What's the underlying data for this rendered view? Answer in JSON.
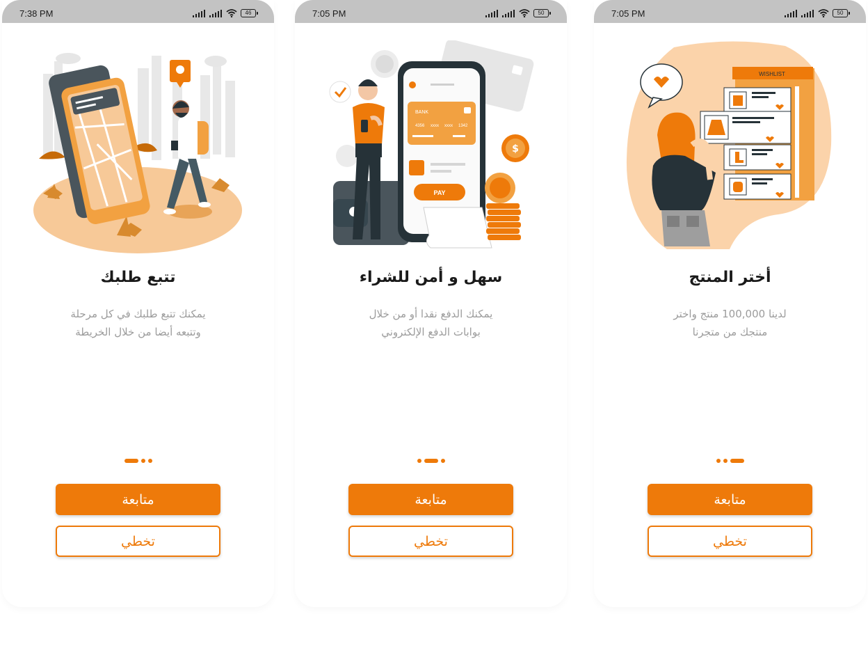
{
  "colors": {
    "accent": "#ee7a0a",
    "status_bar": "#c3c3c3",
    "description_text": "#9c9c9c"
  },
  "screens": [
    {
      "status": {
        "time": "7:38 PM",
        "battery": "46"
      },
      "illustration": "order-tracking-map-illustration",
      "title": "تتبع طلبك",
      "description": [
        "يمكنك تتبع طلبك في كل مرحلة",
        "وتتبعه أيضا من خلال الخريطة"
      ],
      "active_dot": 0,
      "primary_button": "متابعة",
      "secondary_button": "تخطي"
    },
    {
      "status": {
        "time": "7:05 PM",
        "battery": "50"
      },
      "illustration": "secure-payment-illustration",
      "payment_card": {
        "bank": "BANK",
        "number": [
          "4356",
          "xxxx",
          "xxxx",
          "1342"
        ],
        "pay_label": "PAY"
      },
      "title": "سهل و أمن للشراء",
      "description": [
        "يمكنك الدفع نقدا أو من خلال",
        "بوابات الدفع الإلكتروني"
      ],
      "active_dot": 1,
      "primary_button": "متابعة",
      "secondary_button": "تخطي"
    },
    {
      "status": {
        "time": "7:05 PM",
        "battery": "50"
      },
      "illustration": "wishlist-shopping-illustration",
      "wishlist_label": "WISHLIST",
      "title": "أختر المنتج",
      "description": [
        "لدينا 100,000 منتج واختر",
        "منتجك من متجرنا"
      ],
      "active_dot": 2,
      "primary_button": "متابعة",
      "secondary_button": "تخطي"
    }
  ]
}
